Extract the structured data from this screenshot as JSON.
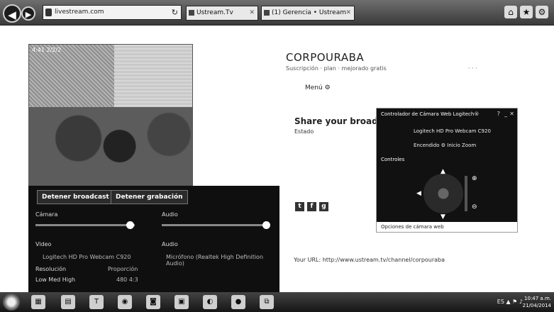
{
  "browser": {
    "address": "livestream.com",
    "tabs": [
      {
        "label": "Ustream.Tv",
        "close": "✕"
      },
      {
        "label": "(1) Gerencia • Ustream",
        "close": "✕"
      }
    ],
    "toolbar_icons": [
      "⌂",
      "★",
      "⚙"
    ]
  },
  "video": {
    "stamp": "4:41 2/2/2"
  },
  "controls": {
    "stop_broadcast": "Detener broadcast",
    "stop_recording": "Detener grabación",
    "camara_label": "Cámara",
    "audio_label": "Audio",
    "camara_level": 0.95,
    "audio_level": 0.98,
    "video_label": "Video",
    "video_value": "Logitech HD Pro Webcam C920",
    "audio_label2": "Audio",
    "audio_value": "Micrófono (Realtek High Definition Audio)",
    "resolution_label": "Resolución",
    "resolution_value": "Proporción",
    "quality_label": "Low  Med  High",
    "quality_value": "480  4:3"
  },
  "page": {
    "org_name": "CORPOURABA",
    "subline": "Suscripción  ·  plan  ·  mejorado gratis",
    "subright": "· · ·",
    "menu": "Menú",
    "share_title": "Share your broadcast",
    "estado": "Estado",
    "social": [
      "t",
      "f",
      "g"
    ],
    "url": "Your URL: http://www.ustream.tv/channel/corpouraba"
  },
  "popup": {
    "title": "Controlador de Cámara Web Logitech®",
    "cam_name": "Logitech HD Pro Webcam C920",
    "recording": "Encendido  ⚙  Inicio Zoom",
    "controles": "Controles",
    "footer": "Opciones de cámara web"
  },
  "taskbar": {
    "tray": "ES  ▲  ⚑  ♪",
    "time": "10:47 a.m.",
    "date": "21/04/2014"
  }
}
